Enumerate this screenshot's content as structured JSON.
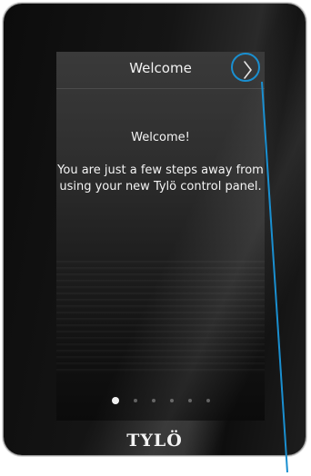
{
  "screen": {
    "title": "Welcome",
    "next_icon": "chevron-right-icon",
    "headline": "Welcome!",
    "message": "You are just a few steps away from using your new Tylö control panel."
  },
  "pagination": {
    "total": 6,
    "active_index": 0
  },
  "brand": {
    "logo_text": "TYLÖ"
  },
  "annotation": {
    "callout_color": "#1a8fd0"
  }
}
